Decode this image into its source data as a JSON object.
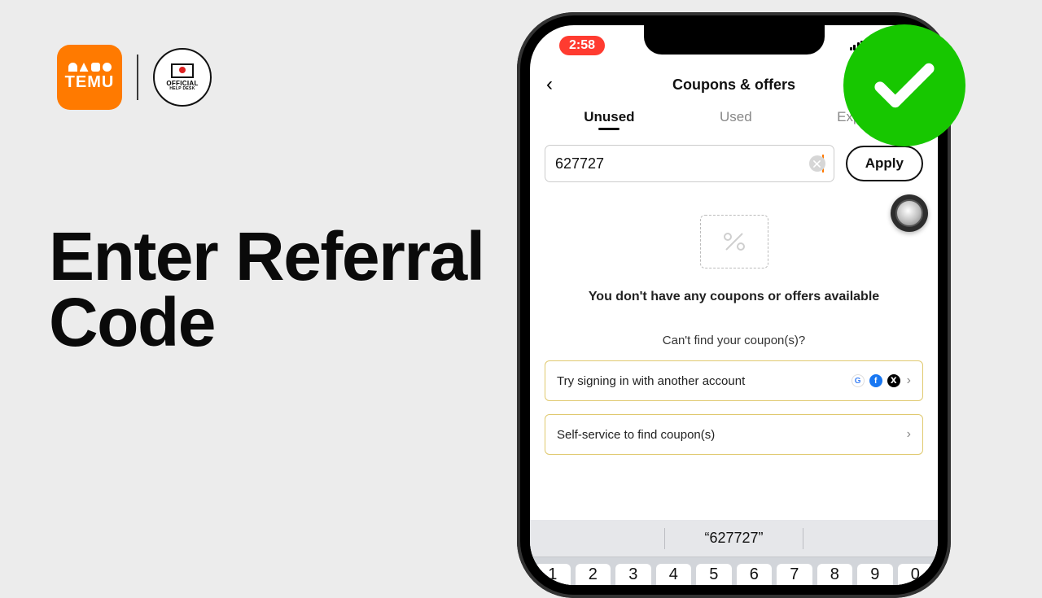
{
  "headline_line1": "Enter Referral",
  "headline_line2": "Code",
  "logos": {
    "temu_label": "TEMU",
    "helpdesk_top": "OFFICIAL",
    "helpdesk_bottom": "HELP DESK"
  },
  "status": {
    "time": "2:58"
  },
  "header": {
    "title": "Coupons & offers"
  },
  "tabs": {
    "unused": "Unused",
    "used": "Used",
    "expired": "Expired"
  },
  "input": {
    "code_value": "627727",
    "apply_label": "Apply"
  },
  "empty": {
    "message": "You don't have any coupons or offers available",
    "hint": "Can't find your coupon(s)?"
  },
  "cards": {
    "signin": "Try signing in with another account",
    "selfservice": "Self-service to find coupon(s)"
  },
  "keyboard": {
    "suggestion": "“627727”",
    "keys": [
      "1",
      "2",
      "3",
      "4",
      "5",
      "6",
      "7",
      "8",
      "9",
      "0"
    ]
  }
}
